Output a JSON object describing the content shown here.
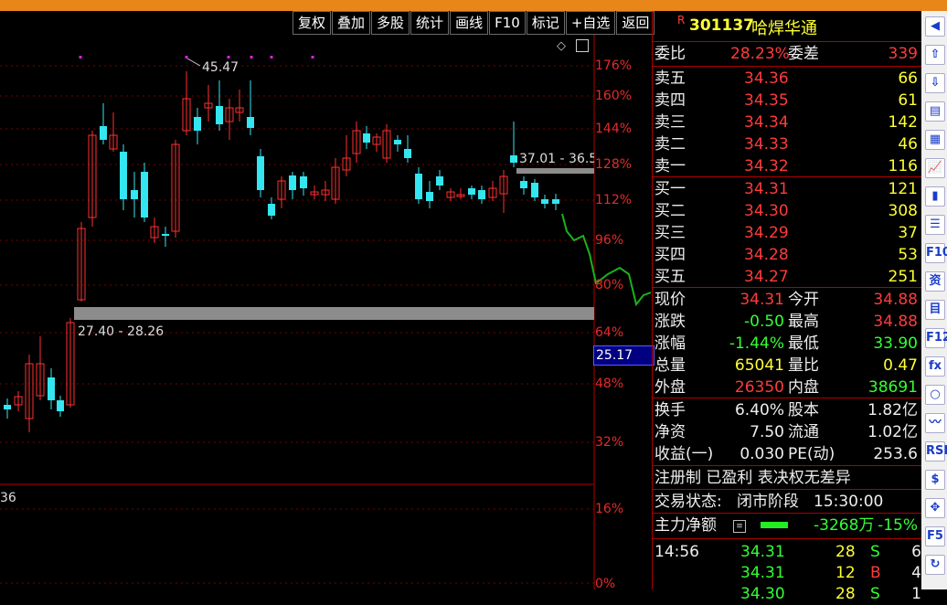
{
  "toolbar": {
    "items": [
      "复权",
      "叠加",
      "多股",
      "统计",
      "画线",
      "F10",
      "标记",
      "+自选",
      "返回"
    ]
  },
  "chart": {
    "y_axis_labels": [
      "176%",
      "160%",
      "144%",
      "128%",
      "112%",
      "96%",
      "80%",
      "64%",
      "48%",
      "32%",
      "16%",
      "0%"
    ],
    "current_value_label": "25.17",
    "high_annotation": "45.47",
    "zone_labels": {
      "lower": "27.40 - 28.26",
      "upper": "37.01 - 36.5"
    },
    "bottom_left_value": "36",
    "colors": {
      "up": "#ff3030",
      "down": "#33e6f0",
      "line": "#1ab21a",
      "zone": "#8c8c8c",
      "grid": "#7a0000",
      "marker": "#e020e0"
    }
  },
  "quote": {
    "badge": "R",
    "code": "301137",
    "name": "哈焊华通",
    "weibi": {
      "label": "委比",
      "value": "28.23%",
      "label2": "委差",
      "value2": "339"
    },
    "sell": [
      {
        "label": "卖五",
        "price": "34.36",
        "vol": "66"
      },
      {
        "label": "卖四",
        "price": "34.35",
        "vol": "61"
      },
      {
        "label": "卖三",
        "price": "34.34",
        "vol": "142"
      },
      {
        "label": "卖二",
        "price": "34.33",
        "vol": "46"
      },
      {
        "label": "卖一",
        "price": "34.32",
        "vol": "116"
      }
    ],
    "buy": [
      {
        "label": "买一",
        "price": "34.31",
        "vol": "121"
      },
      {
        "label": "买二",
        "price": "34.30",
        "vol": "308"
      },
      {
        "label": "买三",
        "price": "34.29",
        "vol": "37"
      },
      {
        "label": "买四",
        "price": "34.28",
        "vol": "53"
      },
      {
        "label": "买五",
        "price": "34.27",
        "vol": "251"
      }
    ],
    "stats": [
      {
        "l1": "现价",
        "v1": "34.31",
        "l2": "今开",
        "v2": "34.88"
      },
      {
        "l1": "涨跌",
        "v1": "-0.50",
        "l2": "最高",
        "v2": "34.88"
      },
      {
        "l1": "涨幅",
        "v1": "-1.44%",
        "l2": "最低",
        "v2": "33.90"
      },
      {
        "l1": "总量",
        "v1": "65041",
        "l2": "量比",
        "v2": "0.47"
      },
      {
        "l1": "外盘",
        "v1": "26350",
        "l2": "内盘",
        "v2": "38691"
      }
    ],
    "fund": [
      {
        "l1": "换手",
        "v1": "6.40%",
        "l2": "股本",
        "v2": "1.82亿"
      },
      {
        "l1": "净资",
        "v1": "7.50",
        "l2": "流通",
        "v2": "1.02亿"
      },
      {
        "l1": "收益(一)",
        "v1": "0.030",
        "l2": "PE(动)",
        "v2": "253.6"
      }
    ],
    "reg": "注册制 已盈利 表决权无差异",
    "status_label": "交易状态:",
    "status_value": "闭市阶段",
    "status_time": "15:30:00",
    "main_label": "主力净额",
    "main_value": "-3268万",
    "main_pct": "-15%",
    "ticks": [
      {
        "time": "14:56",
        "price": "34.31",
        "vol": "28",
        "dir": "S",
        "n": "6"
      },
      {
        "time": "",
        "price": "34.31",
        "vol": "12",
        "dir": "B",
        "n": "4"
      },
      {
        "time": "",
        "price": "34.30",
        "vol": "28",
        "dir": "S",
        "n": "1"
      }
    ]
  },
  "sidebar": {
    "icons": [
      "scroll-up-icon",
      "arrow-up-icon",
      "arrow-down-icon",
      "calc-icon",
      "grid-icon",
      "line-chart-icon",
      "candle-icon",
      "list-icon",
      "f10-icon",
      "news-icon",
      "doc-icon",
      "f12-icon",
      "formula-icon",
      "circle-icon",
      "kline-icon",
      "rsi-icon",
      "dollar-icon",
      "move-icon",
      "f5-icon",
      "refresh-icon"
    ],
    "labels": [
      "◀",
      "⇧",
      "⇩",
      "▤",
      "▦",
      "📈",
      "▮",
      "☰",
      "F10",
      "资",
      "目",
      "F12",
      "fx",
      "○",
      "〰",
      "RSI",
      "$",
      "✥",
      "F5",
      "↻"
    ]
  }
}
